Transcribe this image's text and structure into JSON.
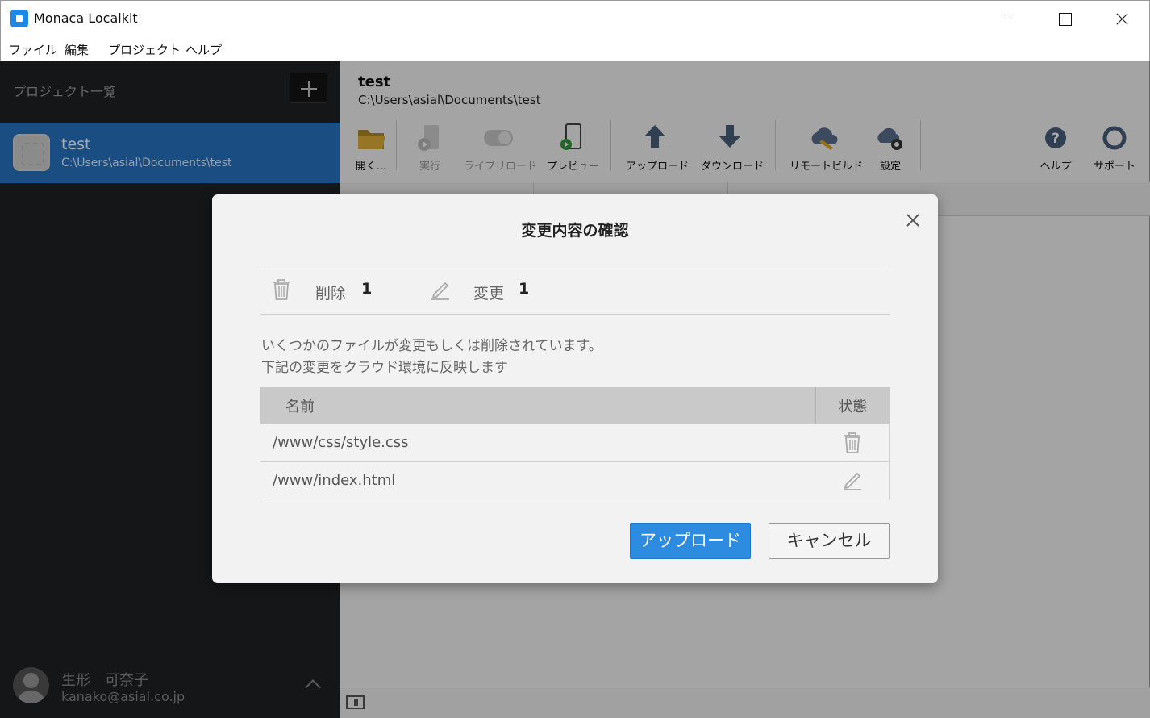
{
  "window": {
    "title": "Monaca Localkit",
    "menu": [
      "ファイル",
      "編集",
      "プロジェクト",
      "ヘルプ"
    ]
  },
  "sidebar": {
    "header": "プロジェクト一覧",
    "projects": [
      {
        "name": "test",
        "path": "C:\\Users\\asial\\Documents\\test"
      }
    ],
    "user": {
      "name": "生形　可奈子",
      "email": "kanako@asial.co.jp"
    }
  },
  "main": {
    "project_title": "test",
    "project_path": "C:\\Users\\asial\\Documents\\test",
    "toolbar": {
      "open": "開く...",
      "run": "実行",
      "livereload": "ライブリロード",
      "preview": "プレビュー",
      "upload": "アップロード",
      "download": "ダウンロード",
      "remote_build": "リモートビルド",
      "settings": "設定",
      "help": "ヘルプ",
      "support": "サポート"
    }
  },
  "dialog": {
    "title": "変更内容の確認",
    "summary": {
      "deleted_label": "削除",
      "deleted_count": "1",
      "modified_label": "変更",
      "modified_count": "1"
    },
    "description_line1": "いくつかのファイルが変更もしくは削除されています。",
    "description_line2": "下記の変更をクラウド環境に反映します",
    "table": {
      "col_name": "名前",
      "col_status": "状態",
      "rows": [
        {
          "path": "/www/css/style.css",
          "status": "trash-icon"
        },
        {
          "path": "/www/index.html",
          "status": "pencil-icon"
        }
      ]
    },
    "upload_button": "アップロード",
    "cancel_button": "キャンセル"
  },
  "colors": {
    "accent": "#2d8be0",
    "sidebar_bg": "#202123",
    "selected_project": "#2873c2"
  }
}
